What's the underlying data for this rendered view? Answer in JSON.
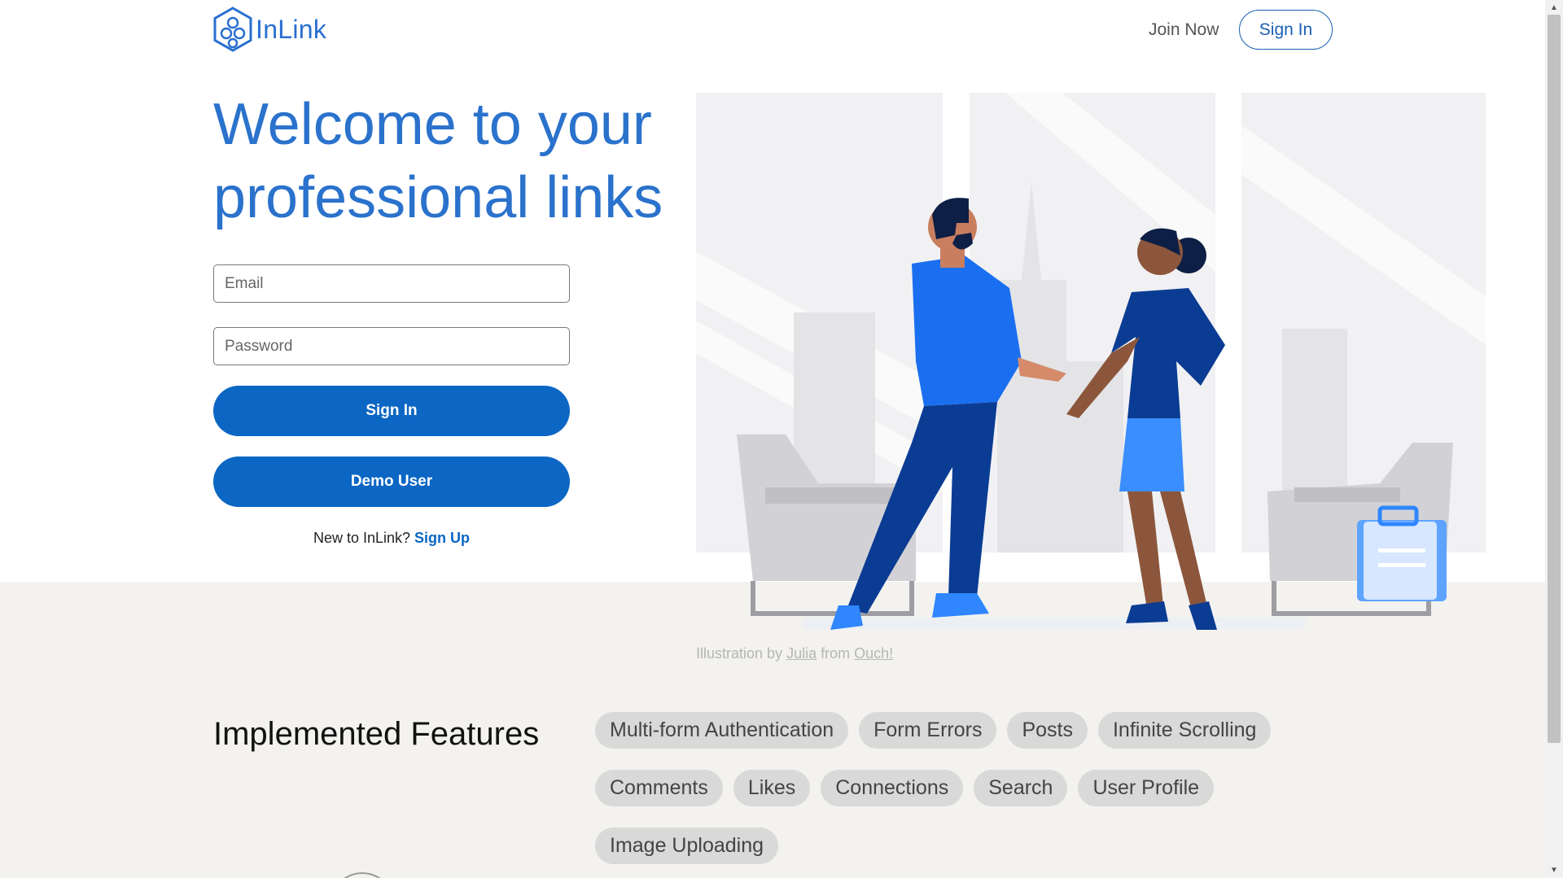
{
  "header": {
    "logo_text": "InLink",
    "join_now": "Join Now",
    "sign_in": "Sign In"
  },
  "hero": {
    "title_line1": "Welcome to your",
    "title_line2": "professional links",
    "email_placeholder": "Email",
    "password_placeholder": "Password",
    "sign_in_button": "Sign In",
    "demo_button": "Demo User",
    "signup_prompt": "New to InLink?",
    "signup_link": "Sign Up"
  },
  "credit": {
    "prefix": "Illustration by",
    "author": "Julia",
    "middle": "from",
    "source": "Ouch!"
  },
  "features": {
    "title": "Implemented Features",
    "items": [
      "Multi-form Authentication",
      "Form Errors",
      "Posts",
      "Infinite Scrolling",
      "Comments",
      "Likes",
      "Connections",
      "Search",
      "User Profile",
      "Image Uploading"
    ]
  },
  "colors": {
    "brand_blue": "#0b66c4",
    "title_blue": "#2a72cc",
    "band_gray": "#f3f2ef",
    "chip_gray": "#d9d9d9"
  },
  "icons": {
    "logo": "hexagon-network-icon",
    "scroll_up": "arrow-up-icon",
    "scroll_down": "arrow-down-icon"
  }
}
